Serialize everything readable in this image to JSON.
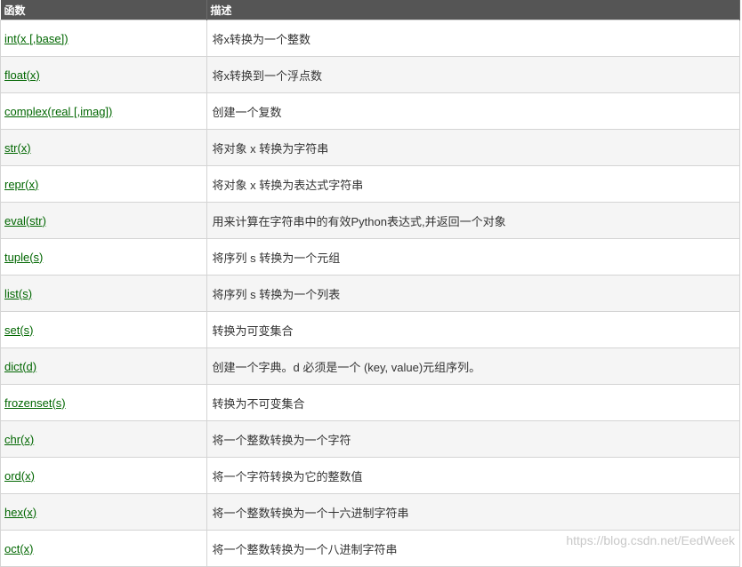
{
  "header": {
    "col_function": "函数",
    "col_description": "描述"
  },
  "rows": [
    {
      "name": "int(x [,base])",
      "description": "将x转换为一个整数"
    },
    {
      "name": "float(x)",
      "description": "将x转换到一个浮点数"
    },
    {
      "name": "complex(real [,imag])",
      "description": "创建一个复数"
    },
    {
      "name": "str(x)",
      "description": "将对象 x 转换为字符串"
    },
    {
      "name": "repr(x)",
      "description": "将对象 x 转换为表达式字符串"
    },
    {
      "name": "eval(str)",
      "description": "用来计算在字符串中的有效Python表达式,并返回一个对象"
    },
    {
      "name": "tuple(s)",
      "description": "将序列 s 转换为一个元组"
    },
    {
      "name": "list(s)",
      "description": "将序列 s 转换为一个列表"
    },
    {
      "name": "set(s)",
      "description": "转换为可变集合"
    },
    {
      "name": "dict(d)",
      "description": "创建一个字典。d 必须是一个 (key, value)元组序列。"
    },
    {
      "name": "frozenset(s)",
      "description": "转换为不可变集合"
    },
    {
      "name": "chr(x)",
      "description": "将一个整数转换为一个字符"
    },
    {
      "name": "ord(x)",
      "description": "将一个字符转换为它的整数值"
    },
    {
      "name": "hex(x)",
      "description": "将一个整数转换为一个十六进制字符串"
    },
    {
      "name": "oct(x)",
      "description": "将一个整数转换为一个八进制字符串"
    }
  ],
  "watermark": "https://blog.csdn.net/EedWeek",
  "colors": {
    "header_bg": "#555555",
    "link": "#006600",
    "row_alt": "#f5f5f5"
  }
}
